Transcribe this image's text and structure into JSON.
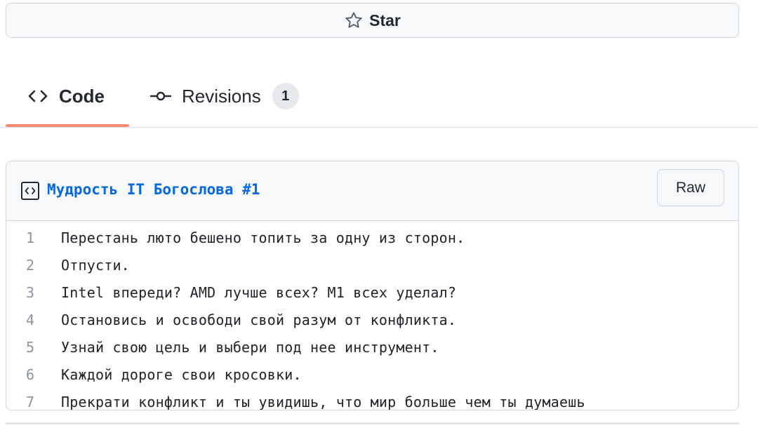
{
  "star_button": {
    "label": "Star",
    "icon": "star-icon"
  },
  "tabs": [
    {
      "label": "Code",
      "icon": "code-icon",
      "active": true
    },
    {
      "label": "Revisions",
      "icon": "git-commit-icon",
      "count": "1"
    }
  ],
  "file": {
    "name": "Мудрость IT Богослова #1",
    "icon": "file-code-icon",
    "raw_label": "Raw",
    "lines": [
      {
        "num": "1",
        "text": "Перестань люто бешено топить за одну из сторон."
      },
      {
        "num": "2",
        "text": "Отпусти."
      },
      {
        "num": "3",
        "text": "Intel впереди? AMD лучше всех? M1 всех уделал?"
      },
      {
        "num": "4",
        "text": "Остановись и освободи свой разум от конфликта."
      },
      {
        "num": "5",
        "text": "Узнай свою цель и выбери под нее инструмент."
      },
      {
        "num": "6",
        "text": "Каждой дороге свои кросовки."
      },
      {
        "num": "7",
        "text": "Прекрати конфликт и ты увидишь, что мир больше чем ты думаешь"
      }
    ]
  },
  "colors": {
    "accent_link": "#0969da",
    "tab_underline": "#fd8c73",
    "border": "#d0d7de",
    "header_bg": "#f6f8fa"
  }
}
